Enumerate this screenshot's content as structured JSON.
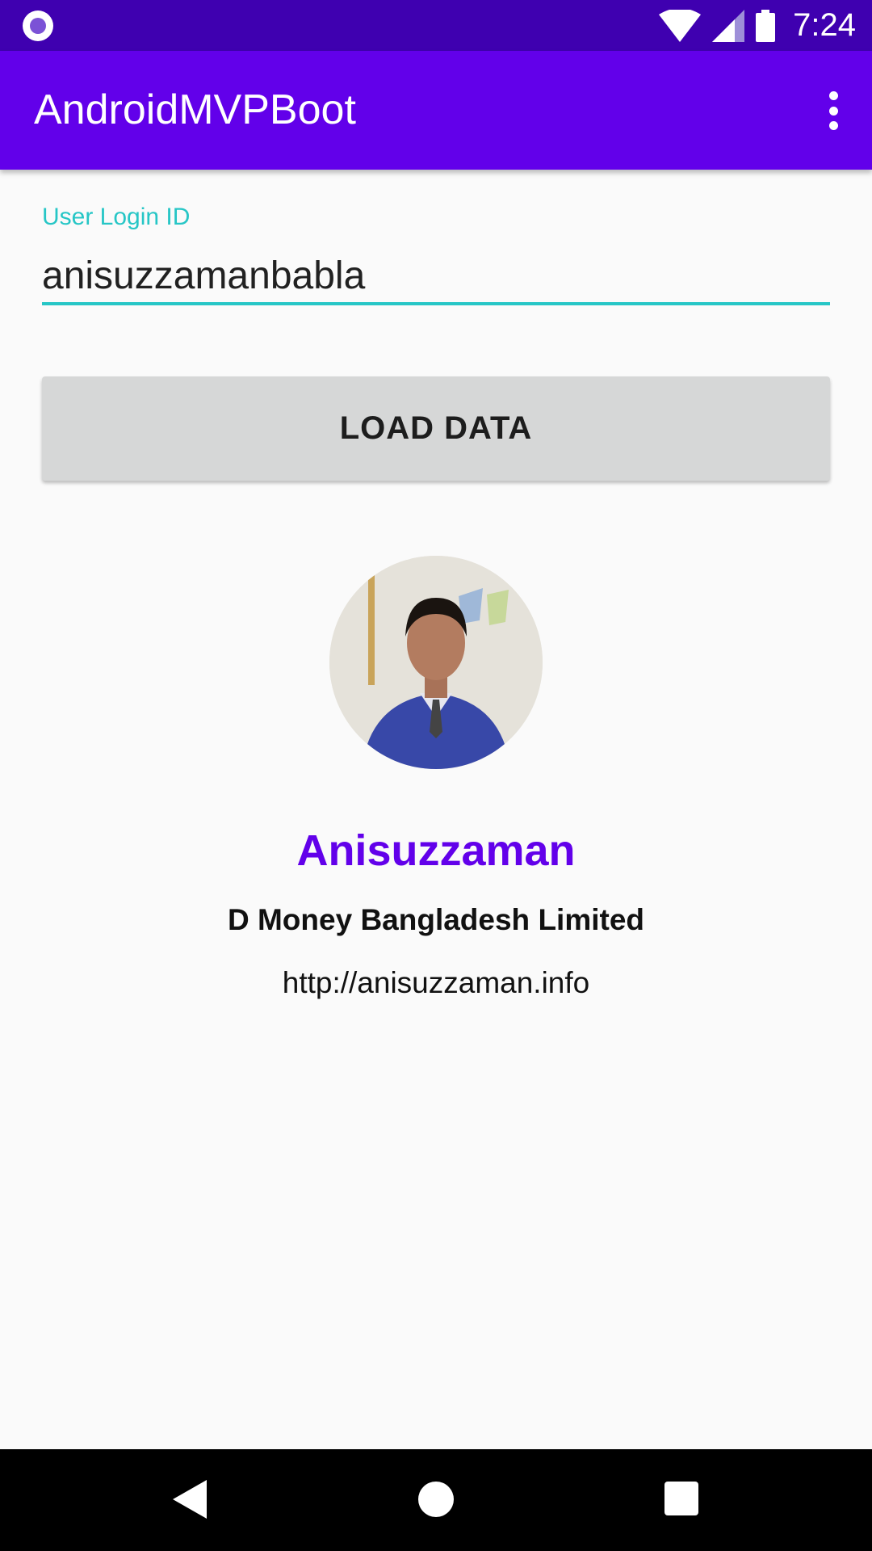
{
  "status_bar": {
    "time": "7:24"
  },
  "app_bar": {
    "title": "AndroidMVPBoot",
    "overflow_icon": "more-vert-icon"
  },
  "form": {
    "login_label": "User Login ID",
    "login_value": "anisuzzamanbabla",
    "load_button_label": "LOAD DATA"
  },
  "profile": {
    "name": "Anisuzzaman",
    "company": "D Money Bangladesh Limited",
    "url": "http://anisuzzaman.info"
  },
  "colors": {
    "primary": "#6200ea",
    "primary_dark": "#3f00b0",
    "accent": "#26c6c6"
  }
}
